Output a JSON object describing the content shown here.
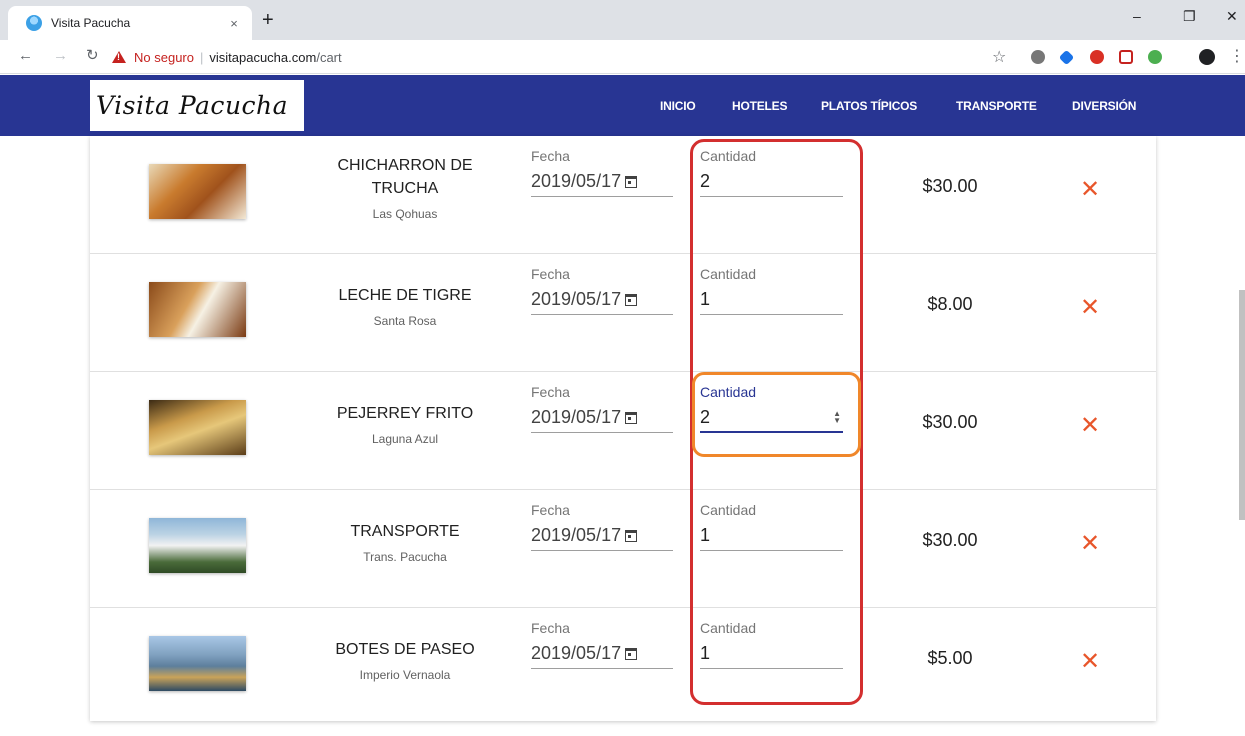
{
  "browser": {
    "tab_title": "Visita Pacucha",
    "close_tab": "×",
    "new_tab": "+",
    "security_label": "No seguro",
    "url_host": "visitapacucha.com",
    "url_path": "/cart"
  },
  "site": {
    "logo": "Visita Pacucha",
    "nav": [
      "INICIO",
      "HOTELES",
      "PLATOS TÍPICOS",
      "TRANSPORTE",
      "DIVERSIÓN"
    ]
  },
  "cart": {
    "date_label": "Fecha",
    "qty_label": "Cantidad",
    "remove_symbol": "✕",
    "items": [
      {
        "name": "CHICHARRON DE TRUCHA",
        "provider": "Las Qohuas",
        "date": "2019/05/17",
        "quantity": "2",
        "price": "$30.00",
        "thumb": "fried-fish-dish"
      },
      {
        "name": "LECHE DE TIGRE",
        "provider": "Santa Rosa",
        "date": "2019/05/17",
        "quantity": "1",
        "price": "$8.00",
        "thumb": "ceviche-drink"
      },
      {
        "name": "PEJERREY FRITO",
        "provider": "Laguna Azul",
        "date": "2019/05/17",
        "quantity": "2",
        "price": "$30.00",
        "thumb": "fried-pejerrey"
      },
      {
        "name": "TRANSPORTE",
        "provider": "Trans. Pacucha",
        "date": "2019/05/17",
        "quantity": "1",
        "price": "$30.00",
        "thumb": "white-van"
      },
      {
        "name": "BOTES DE PASEO",
        "provider": "Imperio Vernaola",
        "date": "2019/05/17",
        "quantity": "1",
        "price": "$5.00",
        "thumb": "lake-boats"
      }
    ]
  },
  "colors": {
    "header": "#283593",
    "remove": "#e8562b",
    "annotation_red": "#d32f2f",
    "annotation_orange": "#f0872a"
  }
}
